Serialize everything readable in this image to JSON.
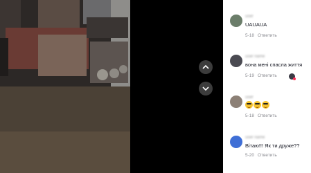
{
  "video": {
    "nav_up_icon": "chevron-up-icon",
    "nav_down_icon": "chevron-down-icon"
  },
  "comments": [
    {
      "avatar_color": "#6b7d6a",
      "text": "UAUAUA",
      "date": "5-18",
      "reply": "Ответить"
    },
    {
      "avatar_color": "#4a4a52",
      "text": "вона мені спасла життя",
      "date": "5-19",
      "reply": "Ответить"
    },
    {
      "avatar_color": "#8c8076",
      "emoji_count": 3,
      "date": "5-18",
      "reply": "Ответить"
    },
    {
      "avatar_color": "#3f6fd6",
      "text": "Вітаю!!! Як ти друже??",
      "date": "5-20",
      "reply": "Ответить"
    }
  ],
  "colors": {
    "panel_bg": "#ffffff",
    "text": "#161823",
    "meta": "#8a8b91"
  }
}
